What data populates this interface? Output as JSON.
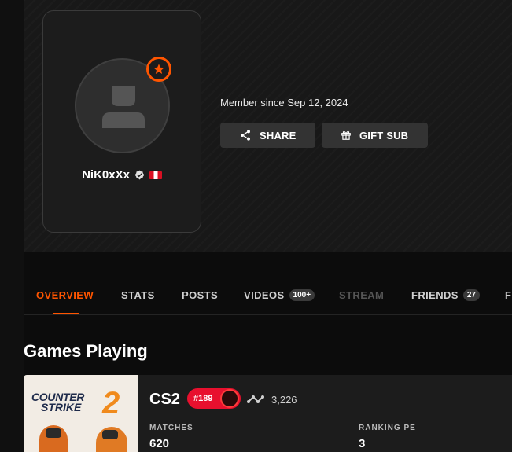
{
  "profile": {
    "nickname": "NiK0xXx",
    "member_since": "Member since Sep 12, 2024",
    "verified_icon": "verified-badge-icon",
    "flag": "peru-flag",
    "level_icon": "star-level-icon"
  },
  "actions": {
    "share_label": "SHARE",
    "gift_label": "GIFT SUB"
  },
  "tabs": [
    {
      "label": "OVERVIEW",
      "state": "active"
    },
    {
      "label": "STATS"
    },
    {
      "label": "POSTS"
    },
    {
      "label": "VIDEOS",
      "badge": "100+"
    },
    {
      "label": "STREAM",
      "state": "disabled"
    },
    {
      "label": "FRIENDS",
      "badge": "27"
    },
    {
      "label": "F"
    }
  ],
  "games_section": {
    "title": "Games Playing",
    "games": [
      {
        "art_line1": "COUNTER",
        "art_line2": "STRIKE",
        "art_number": "2",
        "name": "CS2",
        "rank": "#189",
        "elo": "3,226",
        "stats": [
          {
            "label": "MATCHES",
            "value": "620"
          },
          {
            "label": "RANKING PE",
            "value": "3"
          }
        ]
      }
    ]
  },
  "colors": {
    "accent": "#ff5500",
    "rank_badge": "#e8102e",
    "background": "#0c0c0c"
  }
}
